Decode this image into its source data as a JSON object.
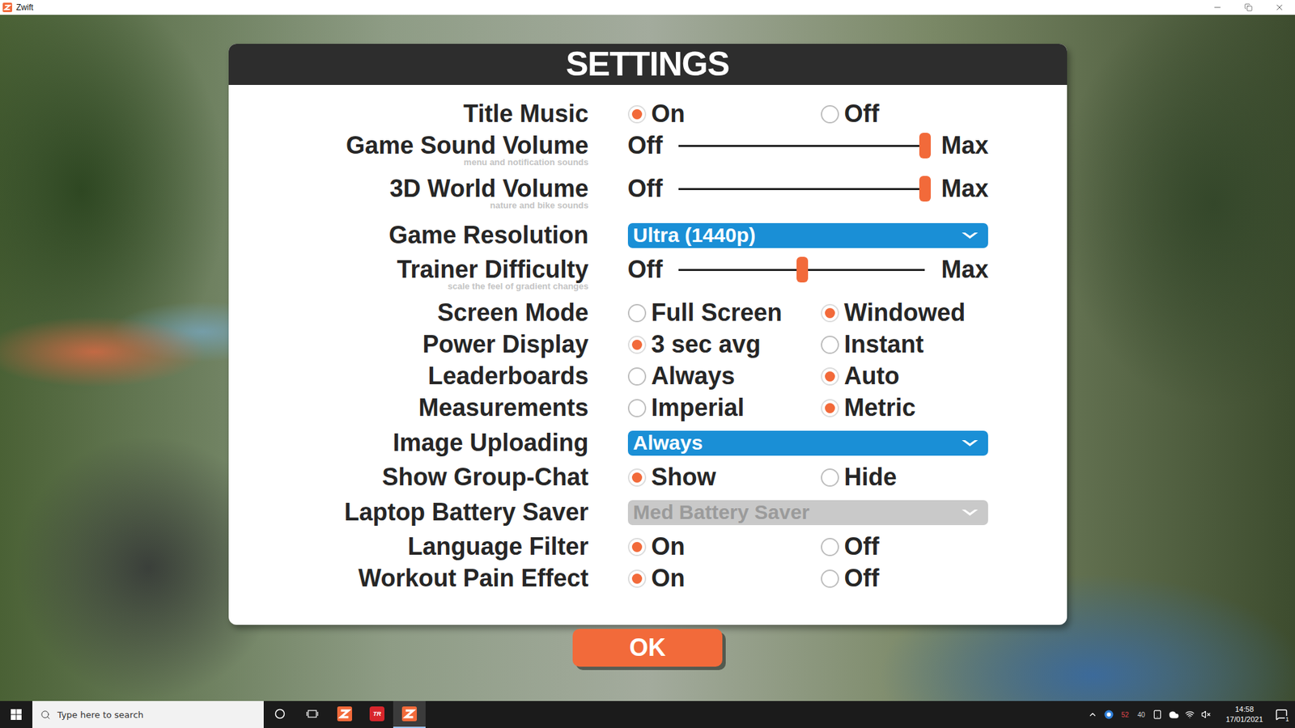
{
  "window": {
    "title": "Zwift"
  },
  "dialog": {
    "title": "SETTINGS",
    "rows": [
      {
        "label": "Title Music",
        "kind": "radio",
        "options": [
          {
            "label": "On",
            "selected": true
          },
          {
            "label": "Off",
            "selected": false
          }
        ]
      },
      {
        "label": "Game Sound Volume",
        "sublabel": "menu and notification sounds",
        "kind": "slider",
        "min_label": "Off",
        "max_label": "Max",
        "level": 1
      },
      {
        "label": "3D World Volume",
        "sublabel": "nature and bike sounds",
        "kind": "slider",
        "min_label": "Off",
        "max_label": "Max",
        "level": 1
      },
      {
        "label": "Game Resolution",
        "kind": "dropdown",
        "value": "Ultra (1440p)",
        "disabled": false
      },
      {
        "label": "Trainer Difficulty",
        "sublabel": "scale the feel of gradient changes",
        "kind": "slider",
        "min_label": "Off",
        "max_label": "Max",
        "level": 0.5
      },
      {
        "label": "Screen Mode",
        "kind": "radio",
        "options": [
          {
            "label": "Full Screen",
            "selected": false
          },
          {
            "label": "Windowed",
            "selected": true
          }
        ]
      },
      {
        "label": "Power Display",
        "kind": "radio",
        "options": [
          {
            "label": "3 sec avg",
            "selected": true
          },
          {
            "label": "Instant",
            "selected": false
          }
        ]
      },
      {
        "label": "Leaderboards",
        "kind": "radio",
        "options": [
          {
            "label": "Always",
            "selected": false
          },
          {
            "label": "Auto",
            "selected": true
          }
        ]
      },
      {
        "label": "Measurements",
        "kind": "radio",
        "options": [
          {
            "label": "Imperial",
            "selected": false
          },
          {
            "label": "Metric",
            "selected": true
          }
        ]
      },
      {
        "label": "Image Uploading",
        "kind": "dropdown",
        "value": "Always",
        "disabled": false
      },
      {
        "label": "Show Group-Chat",
        "kind": "radio",
        "options": [
          {
            "label": "Show",
            "selected": true
          },
          {
            "label": "Hide",
            "selected": false
          }
        ]
      },
      {
        "label": "Laptop Battery Saver",
        "kind": "dropdown",
        "value": "Med Battery Saver",
        "disabled": true
      },
      {
        "label": "Language Filter",
        "kind": "radio",
        "options": [
          {
            "label": "On",
            "selected": true
          },
          {
            "label": "Off",
            "selected": false
          }
        ]
      },
      {
        "label": "Workout Pain Effect",
        "kind": "radio",
        "options": [
          {
            "label": "On",
            "selected": true
          },
          {
            "label": "Off",
            "selected": false
          }
        ]
      }
    ],
    "ok_button": "OK"
  },
  "taskbar": {
    "search": {
      "placeholder": "Type here to search"
    },
    "apps": [
      {
        "kind": "zwift",
        "selected": false
      },
      {
        "kind": "trainerroad",
        "badge": "TR",
        "selected": false
      },
      {
        "kind": "zwift",
        "selected": true
      }
    ],
    "tray": {
      "readings": [
        {
          "text": "52",
          "color": "#e5484d"
        },
        {
          "text": "40",
          "color": "#d0d0d0"
        }
      ],
      "time": "14:58",
      "date": "17/01/2021",
      "notification_count": "1"
    }
  }
}
